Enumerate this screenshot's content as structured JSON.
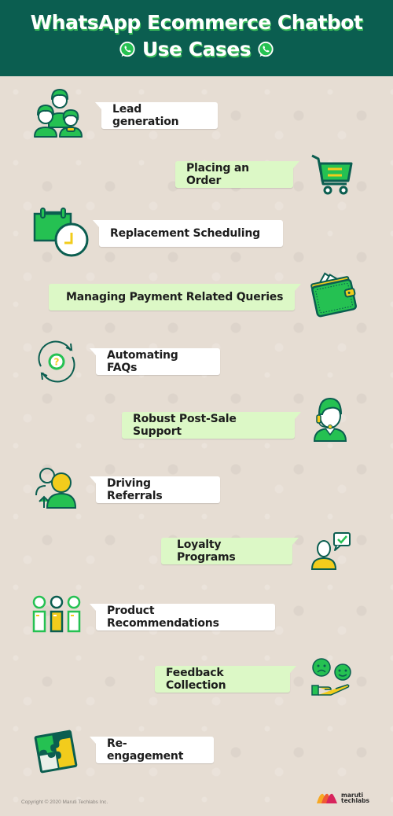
{
  "header": {
    "title_line1": "WhatsApp Ecommerce Chatbot",
    "title_line2": "Use Cases",
    "decor_icon": "whatsapp-icon"
  },
  "colors": {
    "header_bg": "#0b5e50",
    "accent_green": "#25c152",
    "dark_green": "#0b5e50",
    "yellow": "#f2cc1c",
    "bubble_white": "#ffffff",
    "bubble_green": "#dcf8c6",
    "background": "#e6ddd3"
  },
  "use_cases": [
    {
      "label": "Lead generation",
      "icon": "people-group-icon",
      "side": "left",
      "bubble": "white"
    },
    {
      "label": "Placing an Order",
      "icon": "shopping-cart-icon",
      "side": "right",
      "bubble": "green"
    },
    {
      "label": "Replacement Scheduling",
      "icon": "calendar-clock-icon",
      "side": "left",
      "bubble": "white"
    },
    {
      "label": "Managing Payment Related Queries",
      "icon": "wallet-icon",
      "side": "right",
      "bubble": "green"
    },
    {
      "label": "Automating FAQs",
      "icon": "question-refresh-icon",
      "side": "left",
      "bubble": "white"
    },
    {
      "label": "Robust Post-Sale Support",
      "icon": "support-agent-icon",
      "side": "right",
      "bubble": "green"
    },
    {
      "label": "Driving Referrals",
      "icon": "referral-users-icon",
      "side": "left",
      "bubble": "white"
    },
    {
      "label": "Loyalty Programs",
      "icon": "user-checkmark-icon",
      "side": "right",
      "bubble": "green"
    },
    {
      "label": "Product Recommendations",
      "icon": "product-options-icon",
      "side": "left",
      "bubble": "white"
    },
    {
      "label": "Feedback Collection",
      "icon": "feedback-faces-icon",
      "side": "right",
      "bubble": "green"
    },
    {
      "label": "Re-engagement",
      "icon": "puzzle-icon",
      "side": "left",
      "bubble": "white"
    }
  ],
  "footer": {
    "copyright": "Copyright © 2020 Maruti Techlabs Inc.",
    "logo_line1": "maruti",
    "logo_line2": "techlabs"
  }
}
